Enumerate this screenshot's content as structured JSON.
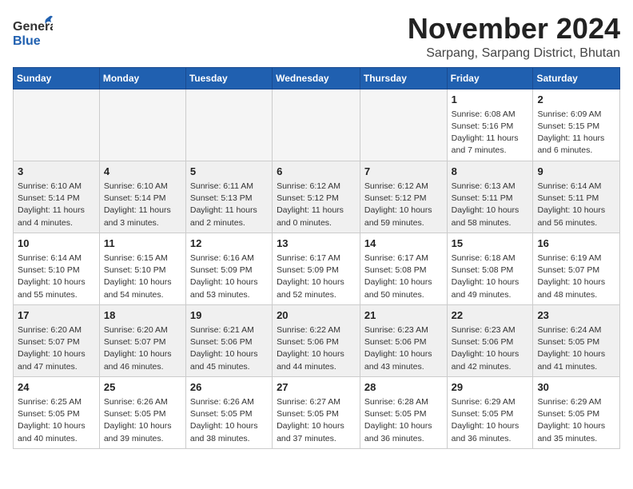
{
  "header": {
    "logo": {
      "general": "General",
      "blue": "Blue"
    },
    "month": "November 2024",
    "location": "Sarpang, Sarpang District, Bhutan"
  },
  "weekdays": [
    "Sunday",
    "Monday",
    "Tuesday",
    "Wednesday",
    "Thursday",
    "Friday",
    "Saturday"
  ],
  "weeks": [
    [
      {
        "day": "",
        "info": "",
        "empty": true
      },
      {
        "day": "",
        "info": "",
        "empty": true
      },
      {
        "day": "",
        "info": "",
        "empty": true
      },
      {
        "day": "",
        "info": "",
        "empty": true
      },
      {
        "day": "",
        "info": "",
        "empty": true
      },
      {
        "day": "1",
        "info": "Sunrise: 6:08 AM\nSunset: 5:16 PM\nDaylight: 11 hours and 7 minutes."
      },
      {
        "day": "2",
        "info": "Sunrise: 6:09 AM\nSunset: 5:15 PM\nDaylight: 11 hours and 6 minutes."
      }
    ],
    [
      {
        "day": "3",
        "info": "Sunrise: 6:10 AM\nSunset: 5:14 PM\nDaylight: 11 hours and 4 minutes."
      },
      {
        "day": "4",
        "info": "Sunrise: 6:10 AM\nSunset: 5:14 PM\nDaylight: 11 hours and 3 minutes."
      },
      {
        "day": "5",
        "info": "Sunrise: 6:11 AM\nSunset: 5:13 PM\nDaylight: 11 hours and 2 minutes."
      },
      {
        "day": "6",
        "info": "Sunrise: 6:12 AM\nSunset: 5:12 PM\nDaylight: 11 hours and 0 minutes."
      },
      {
        "day": "7",
        "info": "Sunrise: 6:12 AM\nSunset: 5:12 PM\nDaylight: 10 hours and 59 minutes."
      },
      {
        "day": "8",
        "info": "Sunrise: 6:13 AM\nSunset: 5:11 PM\nDaylight: 10 hours and 58 minutes."
      },
      {
        "day": "9",
        "info": "Sunrise: 6:14 AM\nSunset: 5:11 PM\nDaylight: 10 hours and 56 minutes."
      }
    ],
    [
      {
        "day": "10",
        "info": "Sunrise: 6:14 AM\nSunset: 5:10 PM\nDaylight: 10 hours and 55 minutes."
      },
      {
        "day": "11",
        "info": "Sunrise: 6:15 AM\nSunset: 5:10 PM\nDaylight: 10 hours and 54 minutes."
      },
      {
        "day": "12",
        "info": "Sunrise: 6:16 AM\nSunset: 5:09 PM\nDaylight: 10 hours and 53 minutes."
      },
      {
        "day": "13",
        "info": "Sunrise: 6:17 AM\nSunset: 5:09 PM\nDaylight: 10 hours and 52 minutes."
      },
      {
        "day": "14",
        "info": "Sunrise: 6:17 AM\nSunset: 5:08 PM\nDaylight: 10 hours and 50 minutes."
      },
      {
        "day": "15",
        "info": "Sunrise: 6:18 AM\nSunset: 5:08 PM\nDaylight: 10 hours and 49 minutes."
      },
      {
        "day": "16",
        "info": "Sunrise: 6:19 AM\nSunset: 5:07 PM\nDaylight: 10 hours and 48 minutes."
      }
    ],
    [
      {
        "day": "17",
        "info": "Sunrise: 6:20 AM\nSunset: 5:07 PM\nDaylight: 10 hours and 47 minutes."
      },
      {
        "day": "18",
        "info": "Sunrise: 6:20 AM\nSunset: 5:07 PM\nDaylight: 10 hours and 46 minutes."
      },
      {
        "day": "19",
        "info": "Sunrise: 6:21 AM\nSunset: 5:06 PM\nDaylight: 10 hours and 45 minutes."
      },
      {
        "day": "20",
        "info": "Sunrise: 6:22 AM\nSunset: 5:06 PM\nDaylight: 10 hours and 44 minutes."
      },
      {
        "day": "21",
        "info": "Sunrise: 6:23 AM\nSunset: 5:06 PM\nDaylight: 10 hours and 43 minutes."
      },
      {
        "day": "22",
        "info": "Sunrise: 6:23 AM\nSunset: 5:06 PM\nDaylight: 10 hours and 42 minutes."
      },
      {
        "day": "23",
        "info": "Sunrise: 6:24 AM\nSunset: 5:05 PM\nDaylight: 10 hours and 41 minutes."
      }
    ],
    [
      {
        "day": "24",
        "info": "Sunrise: 6:25 AM\nSunset: 5:05 PM\nDaylight: 10 hours and 40 minutes."
      },
      {
        "day": "25",
        "info": "Sunrise: 6:26 AM\nSunset: 5:05 PM\nDaylight: 10 hours and 39 minutes."
      },
      {
        "day": "26",
        "info": "Sunrise: 6:26 AM\nSunset: 5:05 PM\nDaylight: 10 hours and 38 minutes."
      },
      {
        "day": "27",
        "info": "Sunrise: 6:27 AM\nSunset: 5:05 PM\nDaylight: 10 hours and 37 minutes."
      },
      {
        "day": "28",
        "info": "Sunrise: 6:28 AM\nSunset: 5:05 PM\nDaylight: 10 hours and 36 minutes."
      },
      {
        "day": "29",
        "info": "Sunrise: 6:29 AM\nSunset: 5:05 PM\nDaylight: 10 hours and 36 minutes."
      },
      {
        "day": "30",
        "info": "Sunrise: 6:29 AM\nSunset: 5:05 PM\nDaylight: 10 hours and 35 minutes."
      }
    ]
  ]
}
